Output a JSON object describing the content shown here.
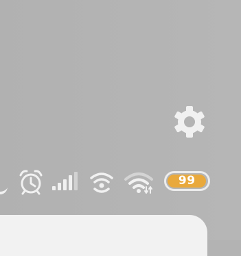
{
  "settings": {
    "icon": "gear-icon"
  },
  "status_bar": {
    "icons": [
      "leaf-icon",
      "alarm-clock-icon",
      "signal-bars-icon",
      "hotspot-icon",
      "wifi-icon"
    ],
    "battery": {
      "label": "99",
      "level_percent": 99,
      "fill_color": "#e9a93c"
    }
  },
  "colors": {
    "background": "#b3b3b3",
    "icon": "#f1f1f1",
    "panel": "#f2f2f2"
  }
}
